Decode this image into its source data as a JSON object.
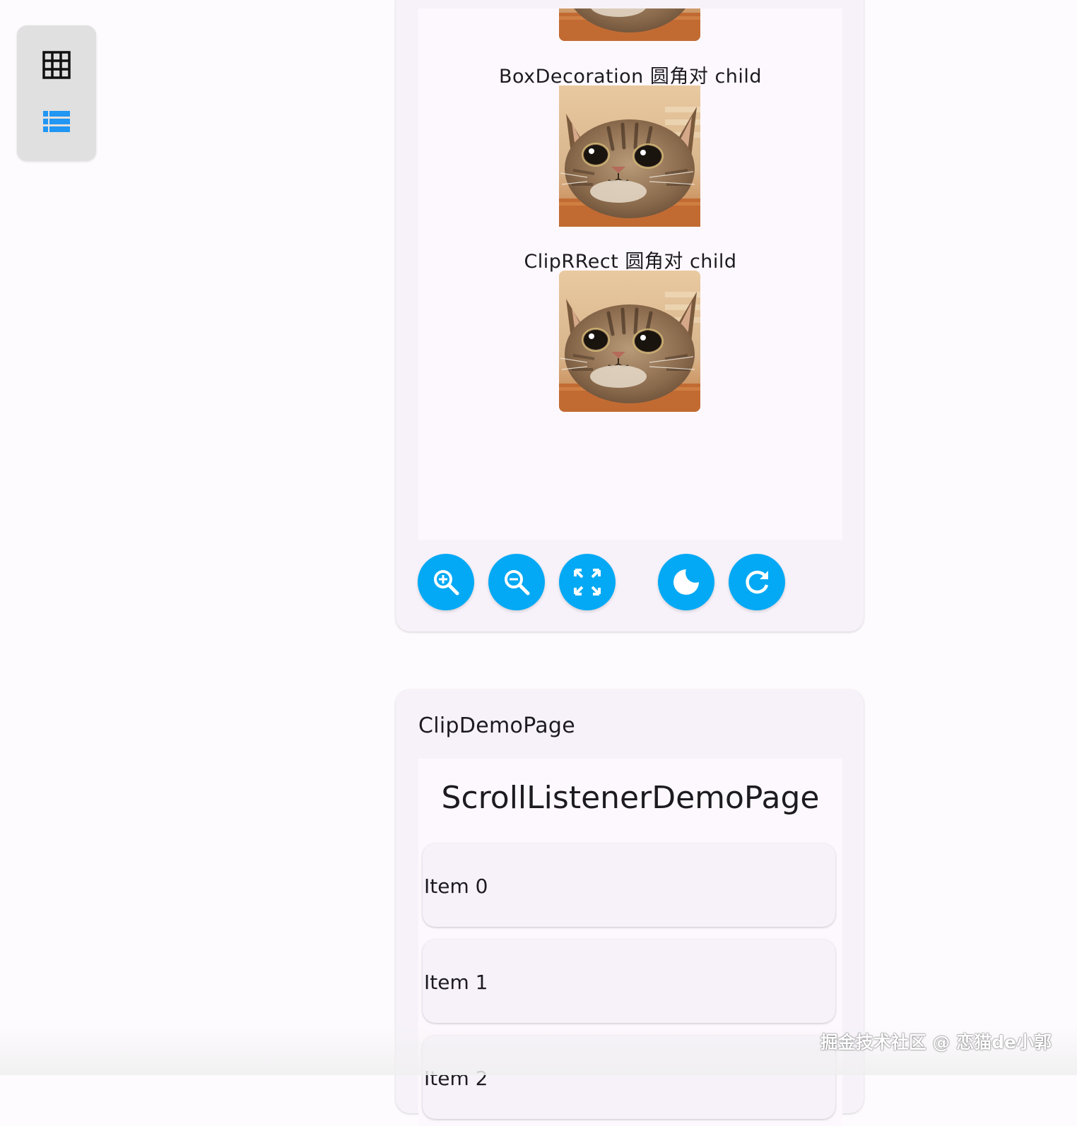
{
  "sidebar": {
    "grid_icon": "grid-view-icon",
    "list_icon": "list-view-icon",
    "active_color": "#2196f3"
  },
  "preview": {
    "captions": [
      "BoxDecoration 圆角对 child",
      "ClipRRect 圆角对 child"
    ],
    "image_subject": "tabby kitten face"
  },
  "toolbar": {
    "buttons": [
      "zoom-in-icon",
      "zoom-out-icon",
      "fullscreen-icon",
      "dark-mode-icon",
      "refresh-icon"
    ],
    "fab_color": "#03a9f4"
  },
  "demo": {
    "page_label": "ClipDemoPage",
    "inner_title": "ScrollListenerDemoPage",
    "items": [
      "Item 0",
      "Item 1",
      "Item 2"
    ]
  },
  "watermark": "掘金技术社区 @ 恋猫de小郭"
}
